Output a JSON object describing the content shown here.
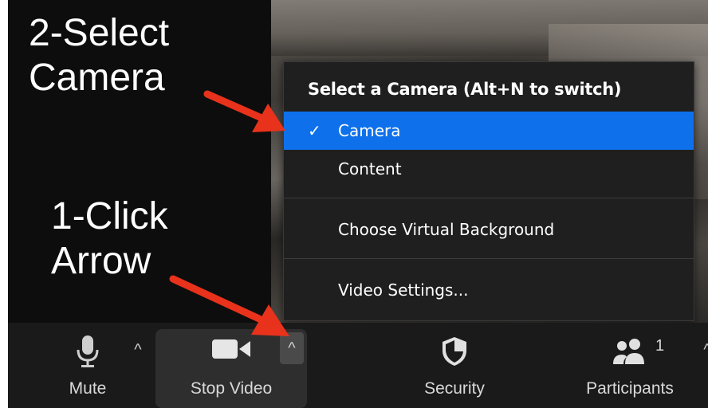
{
  "annotations": {
    "top_line1": "2-Select",
    "top_line2": "Camera",
    "bottom_line1": "1-Click",
    "bottom_line2": "Arrow"
  },
  "menu": {
    "header": "Select a Camera (Alt+N to switch)",
    "items": [
      {
        "label": "Camera",
        "checked": true,
        "selected": true
      },
      {
        "label": "Content",
        "checked": false,
        "selected": false
      },
      {
        "label": "Choose Virtual Background",
        "checked": false,
        "selected": false
      },
      {
        "label": "Video Settings...",
        "checked": false,
        "selected": false
      }
    ],
    "check_glyph": "✓",
    "selected_color": "#0e71eb"
  },
  "toolbar": {
    "mute_label": "Mute",
    "video_label": "Stop Video",
    "security_label": "Security",
    "participants_label": "Participants",
    "participants_count": "1",
    "caret_glyph": "^"
  },
  "icons": {
    "mute": "microphone-icon",
    "video": "video-camera-icon",
    "security": "shield-icon",
    "participants": "people-icon",
    "arrow": "red-arrow-annotation"
  },
  "colors": {
    "annotation_arrow": "#e8321c",
    "toolbar_bg": "#1a1a1a",
    "menu_bg": "#1f1f1f"
  }
}
